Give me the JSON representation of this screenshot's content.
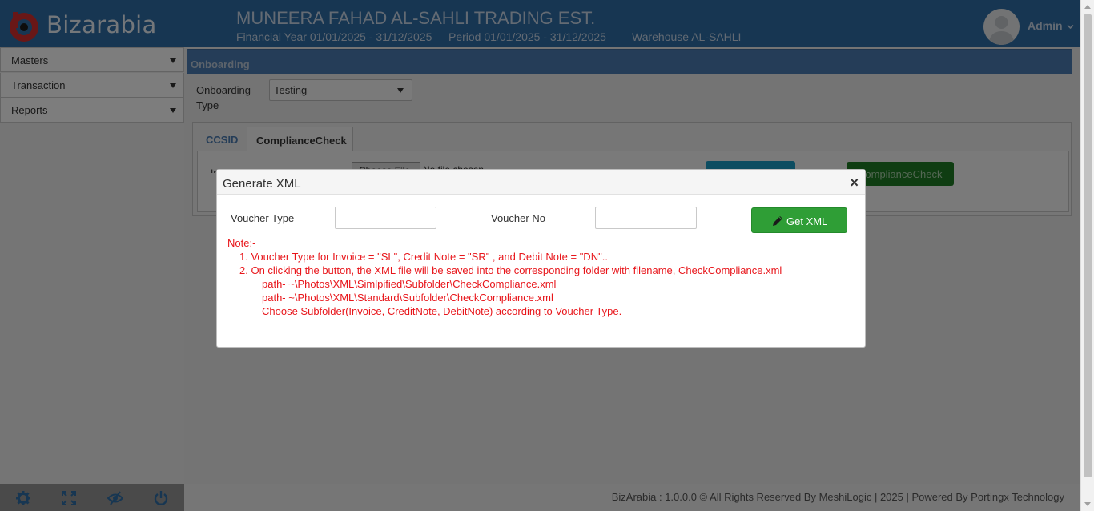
{
  "header": {
    "brand": "Bizarabia",
    "company": "MUNEERA FAHAD AL-SAHLI TRADING EST.",
    "financial_year": "Financial Year 01/01/2025 - 31/12/2025",
    "period": "Period 01/01/2025 - 31/12/2025",
    "warehouse": "Warehouse AL-SAHLI",
    "user": "Admin"
  },
  "sidebar": {
    "items": [
      {
        "label": "Masters"
      },
      {
        "label": "Transaction"
      },
      {
        "label": "Reports"
      }
    ],
    "footer_icons": [
      "settings-icon",
      "fullscreen-icon",
      "hide-icon",
      "power-icon"
    ]
  },
  "main": {
    "panel_title": "Onboarding",
    "onboarding_type_label": "Onboarding Type",
    "onboarding_type_value": "Testing",
    "tabs": [
      {
        "label": "CCSID"
      },
      {
        "label": "ComplianceCheck"
      }
    ],
    "compliance_button": "ComplianceCheck",
    "choose_file": "Choose File",
    "no_file": "No file chosen",
    "invoice_label_fragment": "In"
  },
  "footer": {
    "text": "BizArabia : 1.0.0.0 © All Rights Reserved By MeshiLogic | 2025 | Powered By Portingx Technology"
  },
  "modal": {
    "title": "Generate XML",
    "close": "×",
    "voucher_type_label": "Voucher Type",
    "voucher_type_value": "",
    "voucher_no_label": "Voucher No",
    "voucher_no_value": "",
    "get_xml_button": "Get XML",
    "note": {
      "heading": "Note:-",
      "line1": "1. Voucher Type for Invoice = \"SL\", Credit Note = \"SR\" , and Debit Note = \"DN\"..",
      "line2": "2. On clicking the button, the XML file will be saved into the corresponding folder with filename, CheckCompliance.xml",
      "path1": "path- ~\\Photos\\XML\\Simlpified\\Subfolder\\CheckCompliance.xml",
      "path2": "path- ~\\Photos\\XML\\Standard\\Subfolder\\CheckCompliance.xml",
      "subfolder": "Choose Subfolder(Invoice, CreditNote, DebitNote) according to Voucher Type."
    }
  },
  "colors": {
    "header_bg": "#2e6da4",
    "panel_head": "#4a7bb0",
    "get_xml_green": "#2f9e36",
    "note_red": "#e8161b"
  }
}
